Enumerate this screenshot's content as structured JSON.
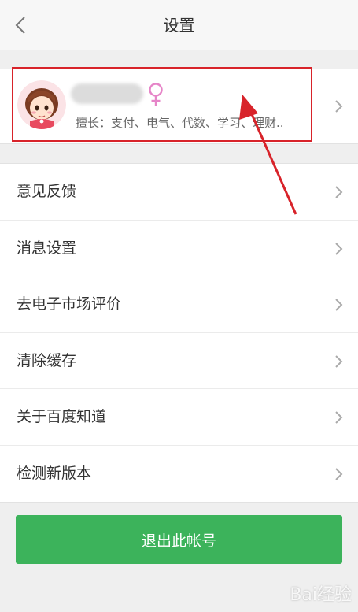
{
  "header": {
    "title": "设置",
    "back_icon": "chevron-left-icon"
  },
  "profile": {
    "gender_icon": "female-icon",
    "skills": "擅长：支付、电气、代数、学习、理财..",
    "highlight_color": "#d8232a"
  },
  "menu": {
    "items": [
      {
        "label": "意见反馈"
      },
      {
        "label": "消息设置"
      },
      {
        "label": "去电子市场评价"
      },
      {
        "label": "清除缓存"
      },
      {
        "label": "关于百度知道"
      },
      {
        "label": "检测新版本"
      }
    ]
  },
  "logout": {
    "label": "退出此帐号",
    "color": "#3cb35b"
  },
  "watermark": {
    "text": "Bai经验"
  },
  "annotation": {
    "arrow_color": "#d8232a"
  }
}
